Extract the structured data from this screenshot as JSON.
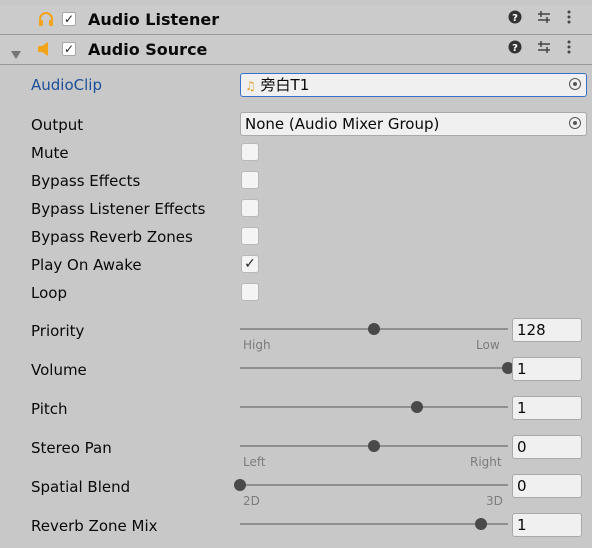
{
  "audio_listener": {
    "title": "Audio Listener",
    "enabled": true
  },
  "audio_source": {
    "title": "Audio Source",
    "enabled": true,
    "audioclip": {
      "label": "AudioClip",
      "value": "旁白T1"
    },
    "output": {
      "label": "Output",
      "value": "None (Audio Mixer Group)"
    },
    "mute": {
      "label": "Mute",
      "checked": false
    },
    "bypass_effects": {
      "label": "Bypass Effects",
      "checked": false
    },
    "bypass_listener_effects": {
      "label": "Bypass Listener Effects",
      "checked": false
    },
    "bypass_reverb_zones": {
      "label": "Bypass Reverb Zones",
      "checked": false
    },
    "play_on_awake": {
      "label": "Play On Awake",
      "checked": true,
      "mark": "✓"
    },
    "loop": {
      "label": "Loop",
      "checked": false
    },
    "priority": {
      "label": "Priority",
      "value": "128",
      "fraction": 0.5,
      "min_label": "High",
      "max_label": "Low"
    },
    "volume": {
      "label": "Volume",
      "value": "1",
      "fraction": 1.0
    },
    "pitch": {
      "label": "Pitch",
      "value": "1",
      "fraction": 0.66
    },
    "stereo_pan": {
      "label": "Stereo Pan",
      "value": "0",
      "fraction": 0.5,
      "min_label": "Left",
      "max_label": "Right"
    },
    "spatial_blend": {
      "label": "Spatial Blend",
      "value": "0",
      "fraction": 0.0,
      "min_label": "2D",
      "max_label": "3D"
    },
    "reverb_zone_mix": {
      "label": "Reverb Zone Mix",
      "value": "1",
      "fraction": 0.9
    }
  },
  "header_icons": [
    "headphones-icon",
    "speaker-icon",
    "help-icon",
    "presets-icon",
    "kebab-menu-icon",
    "foldout-arrow-icon"
  ],
  "colors": {
    "accent": "#3a72c9",
    "label_blue": "#1a4f9a",
    "icon_orange": "#f3a41d"
  },
  "check_mark": "✓"
}
